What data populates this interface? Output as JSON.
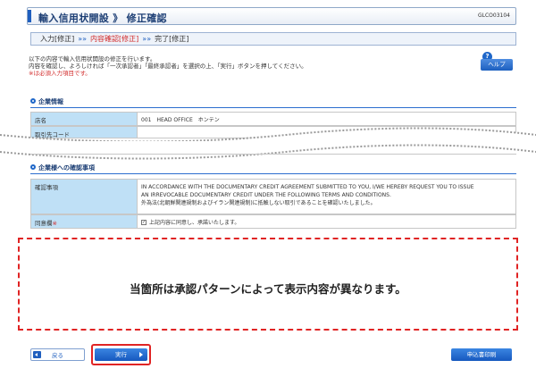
{
  "header": {
    "title": "輸入信用状開設 》 修正確認",
    "screen_id": "GLCO03104"
  },
  "steps": [
    {
      "label": "入力[修正]"
    },
    {
      "label": "内容確認[修正]"
    },
    {
      "label": "完了[修正]"
    }
  ],
  "step_separator": "»»",
  "instructions": {
    "line1": "以下の内容で輸入信用状開設の修正を行います。",
    "line2": "内容を確認し、よろしければ「一次承認者」「最終承認者」を選択の上、「実行」ボタンを押してください。",
    "line3": "※は必須入力項目です。"
  },
  "help": {
    "icon_label": "?",
    "button_label": "ヘルプ"
  },
  "company_section": {
    "heading": "企業情報",
    "store_label": "店名",
    "store_value": "001　HEAD OFFICE　ホンテン",
    "cut_label": "取引先コード"
  },
  "confirm_section": {
    "heading": "企業様への確認事項",
    "item_label": "確認事項",
    "text_line1": "IN ACCORDANCE WITH THE DOCUMENTARY CREDIT AGREEMENT SUBMITTED TO YOU, I/WE HEREBY REQUEST YOU TO ISSUE",
    "text_line2": "AN IRREVOCABLE DOCUMENTARY CREDIT UNDER THE FOLLOWING TERMS AND CONDITIONS.",
    "text_line3": "外為法(北朝鮮関連規制およびイラン関連規制)に抵触しない取引であることを確認いたしました。",
    "agree_label": "同意欄",
    "required_mark": "※",
    "agree_checkbox_label": "上記内容に同意し、承諾いたします。"
  },
  "placeholder_note": "当箇所は承認パターンによって表示内容が異なります。",
  "buttons": {
    "back": "戻る",
    "execute": "実行",
    "print": "申込書印刷"
  },
  "colors": {
    "accent": "#1f5fbf",
    "header_cell": "#bfe0f6",
    "required": "#d22b2b",
    "highlight": "#e02424"
  }
}
